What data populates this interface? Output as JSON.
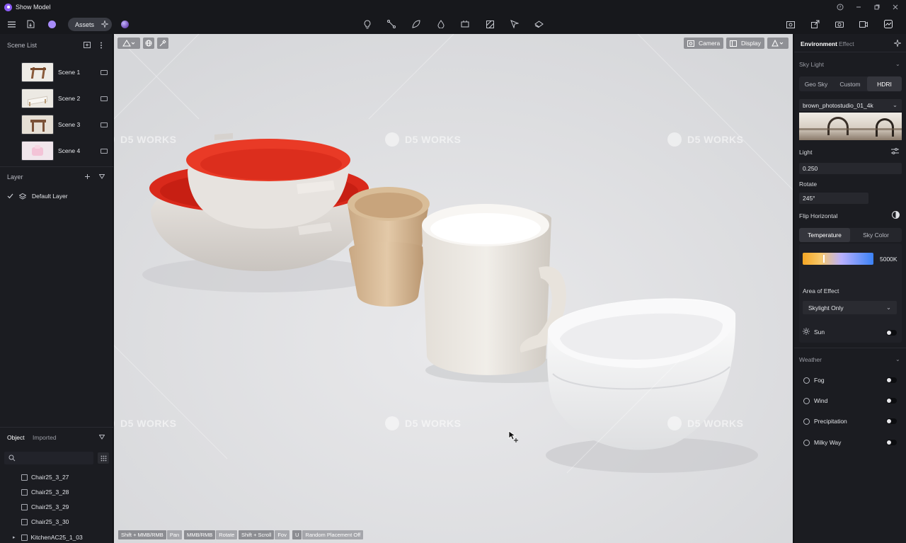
{
  "app": {
    "title": "Show Model"
  },
  "toolbar": {
    "assets_label": "Assets"
  },
  "scene_list": {
    "header": "Scene List",
    "scenes": [
      {
        "label": "Scene 1"
      },
      {
        "label": "Scene 2"
      },
      {
        "label": "Scene 3"
      },
      {
        "label": "Scene 4"
      }
    ]
  },
  "layers": {
    "header": "Layer",
    "items": [
      {
        "label": "Default Layer"
      }
    ]
  },
  "objects": {
    "tabs": [
      "Object",
      "Imported"
    ],
    "items": [
      "Chair25_3_27",
      "Chair25_3_28",
      "Chair25_3_29",
      "Chair25_3_30",
      "KitchenAC25_1_03"
    ]
  },
  "viewport": {
    "camera_label": "Camera",
    "display_label": "Display",
    "watermark": "D5 WORKS",
    "hints": [
      {
        "key": "Shift + MMB/RMB",
        "action": "Pan"
      },
      {
        "key": "MMB/RMB",
        "action": "Rotate"
      },
      {
        "key": "Shift + Scroll",
        "action": "Fov"
      },
      {
        "key": "U",
        "action": "Random Placement Off"
      }
    ]
  },
  "right_panel": {
    "tabs": [
      "Environment",
      "Effect"
    ],
    "sky_light": {
      "header": "Sky Light",
      "modes": [
        "Geo Sky",
        "Custom",
        "HDRI"
      ],
      "active_mode": "HDRI",
      "hdri_name": "brown_photostudio_01_4k",
      "light_label": "Light",
      "light_value": "0.250",
      "rotate_label": "Rotate",
      "rotate_value": "245°",
      "flip_label": "Flip Horizontal",
      "color_tabs": [
        "Temperature",
        "Sky Color"
      ],
      "temperature_value": "5000K",
      "area_label": "Area of Effect",
      "area_value": "Skylight Only",
      "sun_label": "Sun"
    },
    "weather": {
      "header": "Weather",
      "items": [
        "Fog",
        "Wind",
        "Precipitation",
        "Milky Way"
      ]
    }
  },
  "colors": {
    "accent": "#8b5cf6",
    "panel": "#1b1c21",
    "temp_low": "#f5a623",
    "temp_high": "#3b82f6"
  }
}
